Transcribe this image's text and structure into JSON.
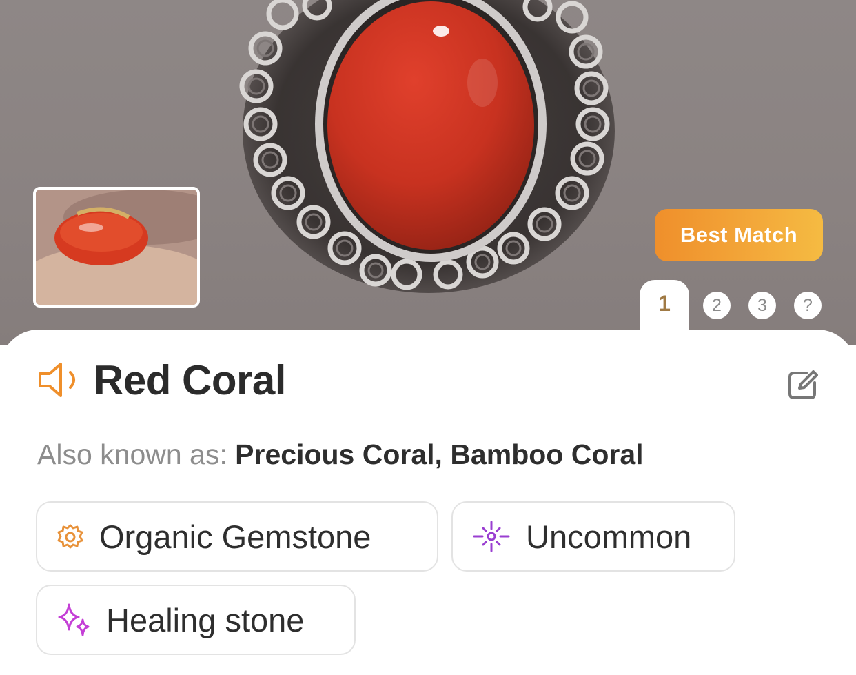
{
  "hero": {
    "badge_label": "Best Match",
    "pages": [
      "1",
      "2",
      "3",
      "?"
    ],
    "active_page": "1"
  },
  "result": {
    "name": "Red Coral",
    "aka_label": "Also known as:",
    "aka_value": "Precious Coral, Bamboo Coral"
  },
  "tags": [
    {
      "label": "Organic Gemstone",
      "icon": "shell-icon",
      "color": "#e8923a"
    },
    {
      "label": "Uncommon",
      "icon": "sparkle-burst-icon",
      "color": "#9a3fd1"
    },
    {
      "label": "Healing stone",
      "icon": "sparkles-icon",
      "color": "#c43fd6"
    }
  ],
  "colors": {
    "accent_orange": "#ef8f2b",
    "badge_gradient_end": "#f5bb42",
    "active_page_text": "#a07a45"
  }
}
